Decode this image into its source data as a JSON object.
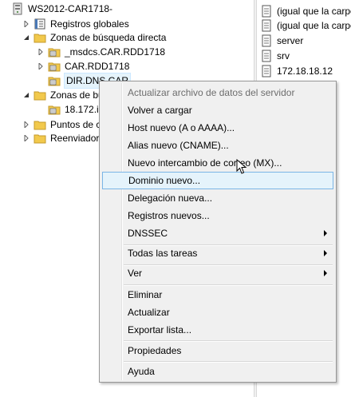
{
  "tree": {
    "root": "WS2012-CAR1718-",
    "items": [
      {
        "label": "Registros globales"
      },
      {
        "label": "Zonas de búsqueda directa"
      },
      {
        "label": "_msdcs.CAR.RDD1718"
      },
      {
        "label": "CAR.RDD1718"
      },
      {
        "label": "DIR.DNS.CAR"
      },
      {
        "label": "Zonas de bu"
      },
      {
        "label": "18.172.in"
      },
      {
        "label": "Puntos de c"
      },
      {
        "label": "Reenviadore"
      }
    ]
  },
  "list": {
    "items": [
      {
        "label": "(igual que la carpe"
      },
      {
        "label": "(igual que la carpe"
      },
      {
        "label": "server"
      },
      {
        "label": "srv"
      },
      {
        "label": "172.18.18.12"
      }
    ]
  },
  "menu": {
    "items": [
      {
        "label": "Actualizar archivo de datos del servidor"
      },
      {
        "label": "Volver a cargar"
      },
      {
        "label": "Host nuevo (A o AAAA)..."
      },
      {
        "label": "Alias nuevo (CNAME)..."
      },
      {
        "label": "Nuevo intercambio de correo (MX)..."
      },
      {
        "label": "Dominio nuevo..."
      },
      {
        "label": "Delegación nueva..."
      },
      {
        "label": "Registros nuevos..."
      },
      {
        "label": "DNSSEC"
      },
      {
        "label": "Todas las tareas"
      },
      {
        "label": "Ver"
      },
      {
        "label": "Eliminar"
      },
      {
        "label": "Actualizar"
      },
      {
        "label": "Exportar lista..."
      },
      {
        "label": "Propiedades"
      },
      {
        "label": "Ayuda"
      }
    ]
  },
  "colors": {
    "highlight_bg": "#e5f3fb",
    "highlight_border": "#7bb5e6",
    "menu_bg": "#f0f0f0",
    "folder": "#f2c94c"
  }
}
